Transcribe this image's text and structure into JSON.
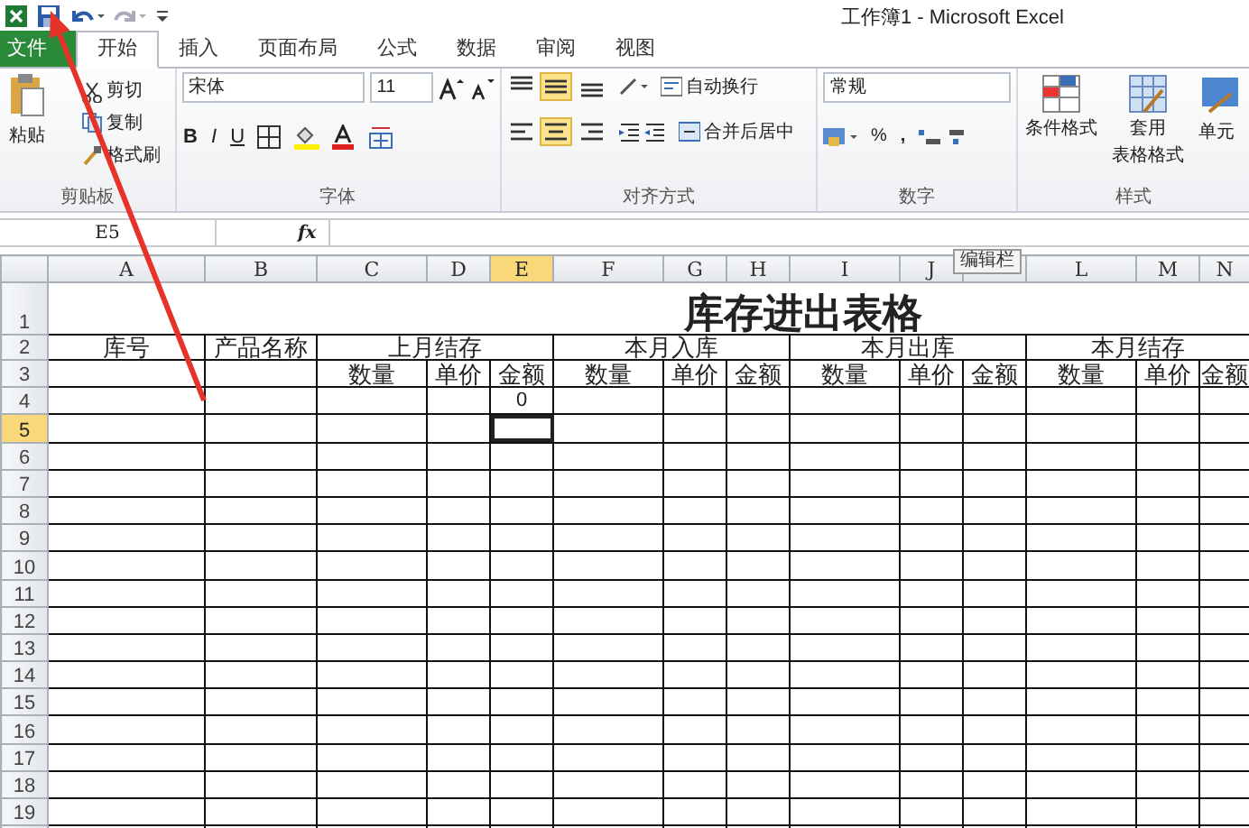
{
  "window": {
    "title": "工作簿1 - Microsoft Excel"
  },
  "ribbon_tabs": [
    {
      "label": "文件",
      "kind": "file",
      "selected": false
    },
    {
      "label": "开始",
      "kind": "tab",
      "selected": true
    },
    {
      "label": "插入",
      "kind": "tab",
      "selected": false
    },
    {
      "label": "页面布局",
      "kind": "tab",
      "selected": false
    },
    {
      "label": "公式",
      "kind": "tab",
      "selected": false
    },
    {
      "label": "数据",
      "kind": "tab",
      "selected": false
    },
    {
      "label": "审阅",
      "kind": "tab",
      "selected": false
    },
    {
      "label": "视图",
      "kind": "tab",
      "selected": false
    }
  ],
  "ribbon": {
    "clipboard": {
      "paste": "粘贴",
      "cut": "剪切",
      "copy": "复制",
      "format_painter": "格式刷",
      "group": "剪贴板"
    },
    "font": {
      "name": "宋体",
      "size": "11",
      "bold": "B",
      "italic": "I",
      "underline": "U",
      "group": "字体"
    },
    "alignment": {
      "vertical": [
        {
          "selected": false
        },
        {
          "selected": true
        },
        {
          "selected": false
        }
      ],
      "horizontal": [
        {
          "selected": false
        },
        {
          "selected": true
        },
        {
          "selected": false
        }
      ],
      "wrap": "自动换行",
      "merge": "合并后居中",
      "group": "对齐方式"
    },
    "number": {
      "format": "常规",
      "percent": "%",
      "comma": ",",
      "group": "数字"
    },
    "styles": {
      "conditional": "条件格式",
      "table_format": [
        "套用",
        "表格格式"
      ],
      "cell_styles": "单元",
      "group": "样式"
    }
  },
  "formula_bar": {
    "name_box": "E5",
    "fx": "fx"
  },
  "sheet": {
    "columns": [
      {
        "label": "A",
        "selected": false
      },
      {
        "label": "B",
        "selected": false
      },
      {
        "label": "C",
        "selected": false
      },
      {
        "label": "D",
        "selected": false
      },
      {
        "label": "E",
        "selected": true
      },
      {
        "label": "F",
        "selected": false
      },
      {
        "label": "G",
        "selected": false
      },
      {
        "label": "H",
        "selected": false
      },
      {
        "label": "I",
        "selected": false
      },
      {
        "label": "J",
        "selected": false
      },
      {
        "tooltip": "编辑栏",
        "selected": false
      },
      {
        "label": "L",
        "selected": false
      },
      {
        "label": "M",
        "selected": false
      },
      {
        "label": "N",
        "selected": false
      }
    ],
    "title": "库存进出表格",
    "header_groups": [
      {
        "label": "库号"
      },
      {
        "label": "产品名称"
      },
      {
        "label": "上月结存",
        "sub": [
          "数量",
          "单价",
          "金额"
        ]
      },
      {
        "label": "本月入库",
        "sub": [
          "数量",
          "单价",
          "金额"
        ]
      },
      {
        "label": "本月出库",
        "sub": [
          "数量",
          "单价",
          "金额"
        ]
      },
      {
        "label": "本月结存",
        "sub": [
          "数量",
          "单价",
          "金额"
        ]
      }
    ],
    "rows": [
      {
        "header": "1",
        "selected": false
      },
      {
        "header": "2",
        "selected": false
      },
      {
        "header": "3",
        "selected": false
      },
      {
        "header": "4",
        "selected": false,
        "cells": [
          null,
          null,
          null,
          null,
          "0"
        ]
      },
      {
        "header": "5",
        "selected": true
      },
      {
        "header": "6",
        "selected": false
      },
      {
        "header": "7",
        "selected": false
      },
      {
        "header": "8",
        "selected": false
      },
      {
        "header": "9",
        "selected": false
      },
      {
        "header": "10",
        "selected": false
      },
      {
        "header": "11",
        "selected": false
      },
      {
        "header": "12",
        "selected": false
      },
      {
        "header": "13",
        "selected": false
      },
      {
        "header": "14",
        "selected": false
      },
      {
        "header": "15",
        "selected": false
      },
      {
        "header": "16",
        "selected": false
      },
      {
        "header": "17",
        "selected": false
      },
      {
        "header": "18",
        "selected": false
      },
      {
        "header": "19",
        "selected": false
      }
    ]
  }
}
